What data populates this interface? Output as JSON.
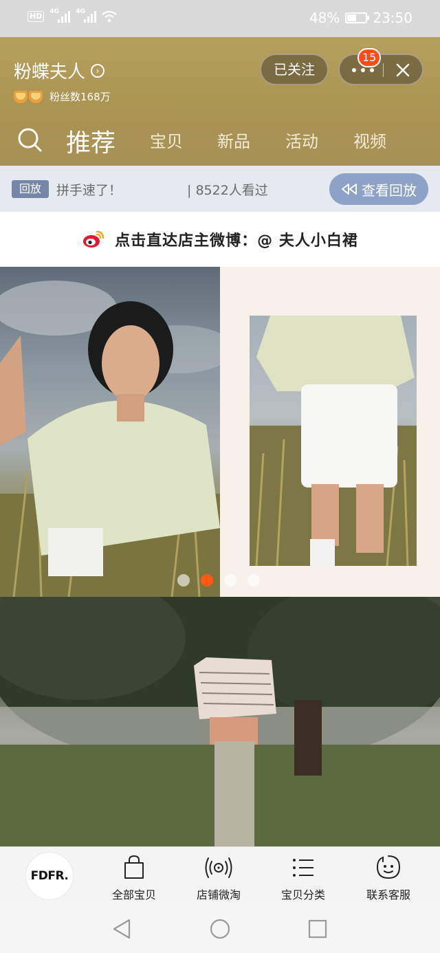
{
  "status_bar": {
    "hd": "HD",
    "network_1": "4G",
    "network_2": "4G",
    "battery_percent": "48%",
    "battery_level": 0.48,
    "time": "23:50",
    "icons": [
      "signal-icon",
      "wifi-icon",
      "battery-icon"
    ]
  },
  "store": {
    "name": "粉蝶夫人",
    "fans": "粉丝数168万",
    "follow_label": "已关注",
    "notification_count": "15"
  },
  "nav": {
    "tabs": [
      {
        "label": "推荐",
        "active": true
      },
      {
        "label": "宝贝",
        "active": false
      },
      {
        "label": "新品",
        "active": false
      },
      {
        "label": "活动",
        "active": false
      },
      {
        "label": "视频",
        "active": false
      }
    ]
  },
  "replay": {
    "tag": "回放",
    "title": "拼手速了！",
    "views": "| 8522人看过",
    "button_label": "查看回放"
  },
  "weibo": {
    "text": "点击直达店主微博：@ 夫人小白裙",
    "icon": "weibo-icon",
    "icon_color": "#e6162d"
  },
  "carousel": {
    "page_count": 4,
    "active_index": 1,
    "active_color": "#ff5a10"
  },
  "shop_bar": {
    "logo_text": "FDFR.",
    "items": [
      {
        "label": "全部宝贝",
        "icon": "shopping-bag-icon"
      },
      {
        "label": "店铺微淘",
        "icon": "broadcast-icon"
      },
      {
        "label": "宝贝分类",
        "icon": "list-icon"
      },
      {
        "label": "联系客服",
        "icon": "chat-face-icon"
      }
    ]
  },
  "system_nav": {
    "buttons": [
      "back-icon",
      "home-icon",
      "recents-icon"
    ]
  },
  "colors": {
    "header_gold": "#b09a58",
    "replay_button": "#8da2c7",
    "badge_red": "#ff4a1c"
  }
}
